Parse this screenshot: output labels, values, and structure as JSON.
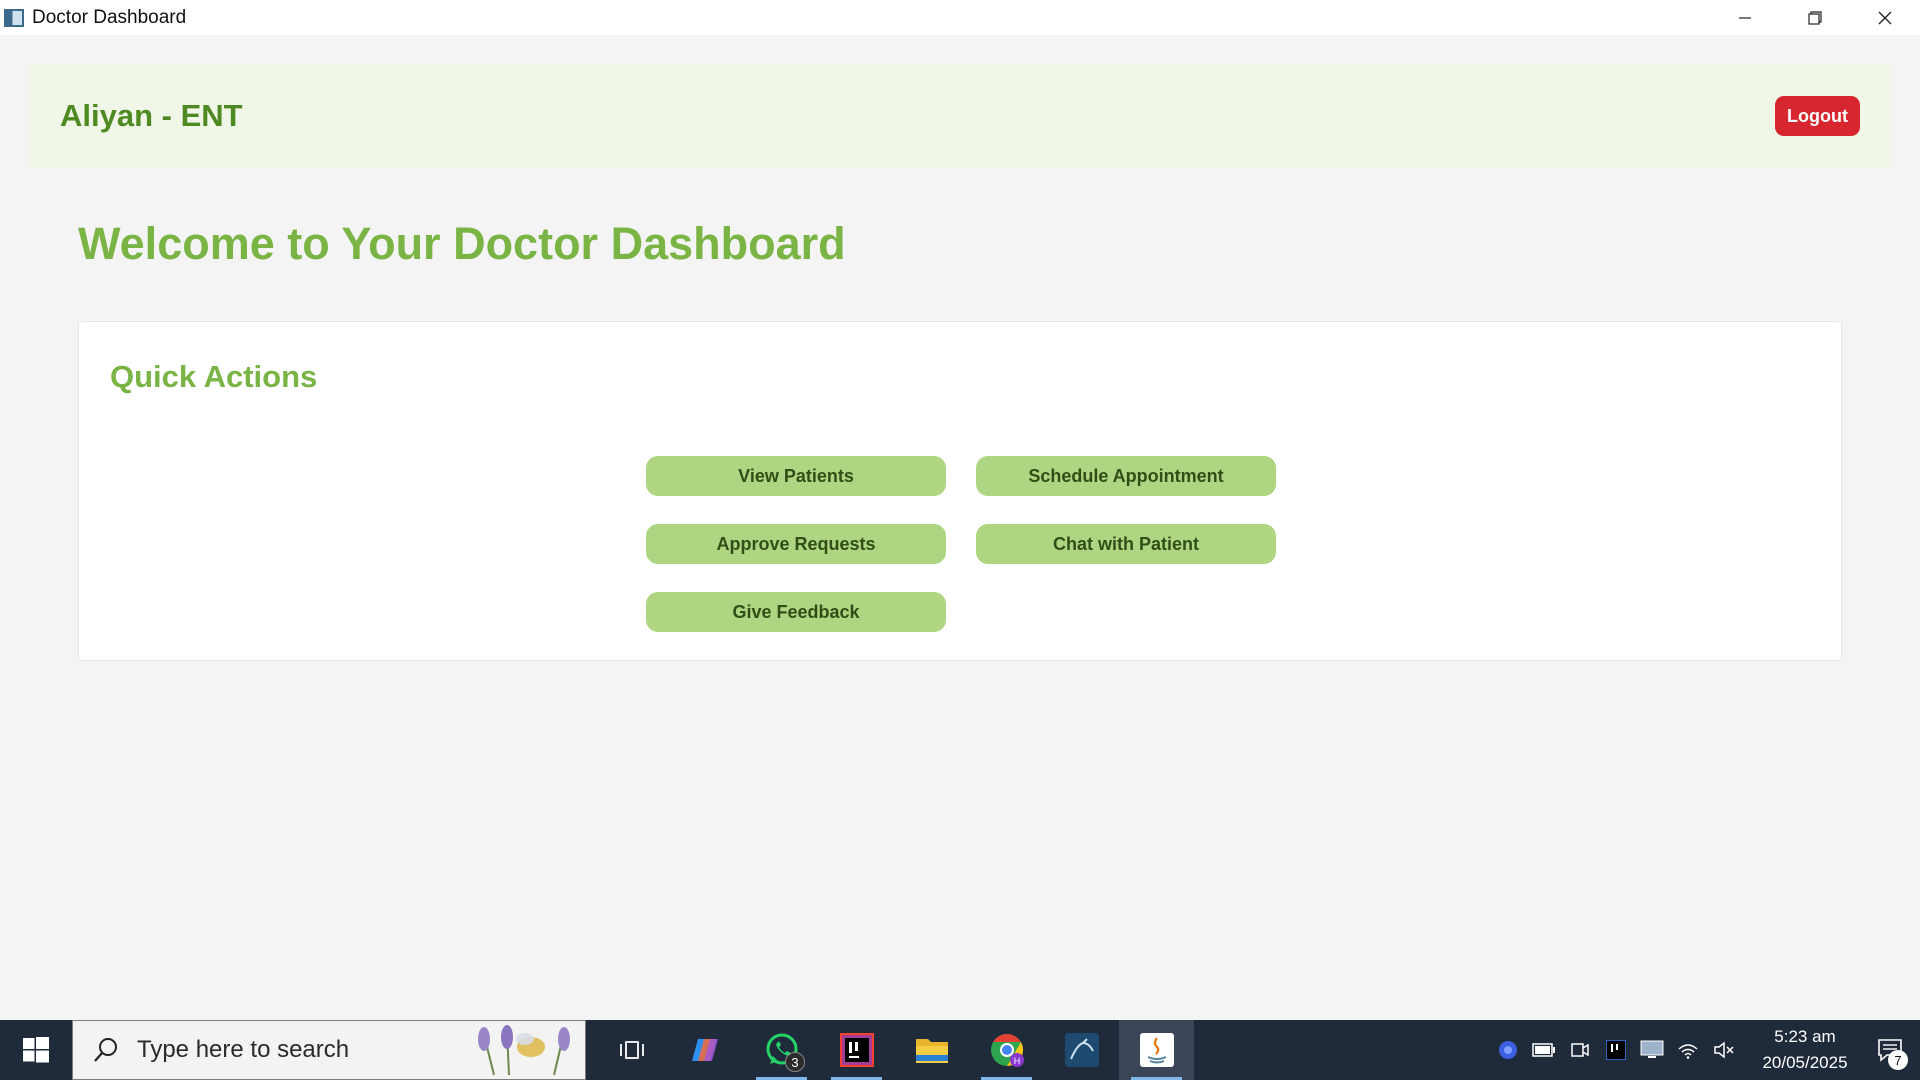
{
  "window": {
    "title": "Doctor Dashboard",
    "controls": [
      "minimize-icon",
      "restore-icon",
      "close-icon"
    ]
  },
  "header": {
    "doctor_name": "Aliyan - ENT",
    "logout_label": "Logout"
  },
  "main": {
    "welcome": "Welcome to Your Doctor Dashboard",
    "quick_actions": {
      "title": "Quick Actions",
      "buttons": [
        {
          "label": "View Patients"
        },
        {
          "label": "Schedule Appointment"
        },
        {
          "label": "Approve Requests"
        },
        {
          "label": "Chat with Patient"
        },
        {
          "label": "Give Feedback"
        }
      ]
    }
  },
  "taskbar": {
    "search_placeholder": "Type here to search",
    "apps": [
      "task-view-icon",
      "copilot-icon",
      "whatsapp-icon",
      "intellij-icon",
      "file-explorer-icon",
      "chrome-icon",
      "mysql-workbench-icon",
      "java-icon"
    ],
    "whatsapp_badge": "3",
    "clock": {
      "time": "5:23 am",
      "date": "20/05/2025"
    },
    "notification_count": "7"
  },
  "colors": {
    "accent_green": "#7ab444",
    "dark_green": "#4e8a22",
    "button_green": "#aed582",
    "logout_red": "#d7262f",
    "taskbar_bg": "#1f2a3a"
  }
}
